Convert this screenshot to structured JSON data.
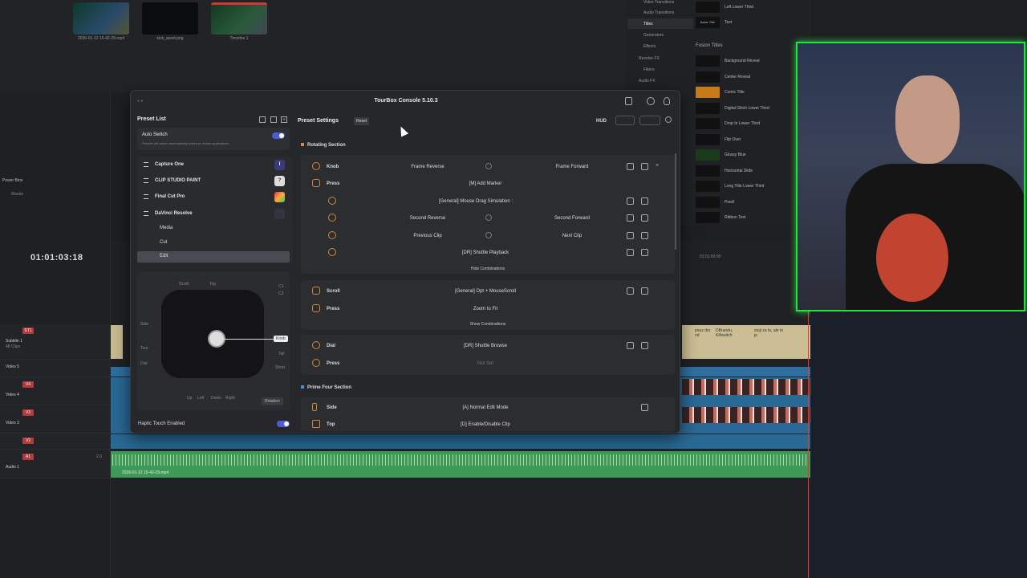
{
  "media_pool": {
    "clips": [
      {
        "label": "2026-01-12 15-42-29.mp4"
      },
      {
        "label": "kick_asset.png"
      },
      {
        "label": "Timeline 1"
      }
    ]
  },
  "left_panel": {
    "power_bins": "Power Bins",
    "master": "Master",
    "timecode": "01:01:03:18"
  },
  "tracks": [
    {
      "badge": "ST1",
      "name": "Subtitle 1",
      "sub": "48 Clips"
    },
    {
      "badge": "V5",
      "name": "Video 5"
    },
    {
      "badge": "V4",
      "name": "Video 4"
    },
    {
      "badge": "V3",
      "name": "Video 3"
    },
    {
      "badge": "V2",
      "name": ""
    },
    {
      "badge": "A1",
      "name": "Audio 1",
      "level": "2.0"
    }
  ],
  "audio_clip_label": "2026-01-12 15-42-29.mp4",
  "timeline_ruler": "01:01:00:00",
  "subtitle_clips": [
    "pouz dro od",
    "DBrandu, Killswitch",
    "stoji za to, ale to je"
  ],
  "effects": {
    "nav": [
      "Video Transitions",
      "Audio Transitions",
      "Titles",
      "Generators",
      "Effects",
      "Resolve FX",
      "Filters",
      "Audio FX"
    ],
    "top_items": [
      "Left Lower Third",
      "Text"
    ],
    "top_swatch": "Basic Title",
    "fusion_header": "Fusion Titles",
    "fusion_items": [
      "Background Reveal",
      "Center Reveal",
      "Comic Title",
      "Digital Glitch Lower Third",
      "Drop In Lower Third",
      "Flip Over",
      "Glossy Blue",
      "Horizontal Slide",
      "Long Title Lower Third",
      "Powll",
      "Ribbon Text"
    ],
    "swatch_texts": [
      "SAMPLE",
      "Glossy Blue"
    ]
  },
  "console": {
    "title": "TourBox Console 5.10.3",
    "preset_list_title": "Preset List",
    "auto_switch": "Auto Switch",
    "auto_switch_desc": "Presets will switch automatically based on linked applications.",
    "presets": [
      {
        "label": "Capture One"
      },
      {
        "label": "CLIP STUDIO PAINT"
      },
      {
        "label": "Final Cut Pro"
      },
      {
        "label": "DaVinci Resolve"
      }
    ],
    "sub_presets": [
      "Media",
      "Cut",
      "Edit"
    ],
    "device_labels": {
      "scroll": "Scroll",
      "top": "Top",
      "c1": "C1",
      "c2": "C2",
      "side": "Side",
      "tour": "Tour",
      "dial": "Dial",
      "knob": "Knob",
      "tall": "Tall",
      "short": "Short",
      "up": "Up",
      "left": "Left",
      "down": "Down",
      "right": "Right",
      "rotation": "Rotation"
    },
    "haptic": "Haptic Touch Enabled",
    "preset_settings": "Preset Settings",
    "reset": "Reset",
    "hud": "HUD",
    "rotating_section": "Rotating Section",
    "knob_rows": [
      {
        "name": "Knob",
        "left": "Frame Reverse",
        "right": "Frame Forward"
      },
      {
        "name": "Press",
        "center": "[M] Add Marker"
      },
      {
        "center": "[General] Mouse Drag Simulation :"
      },
      {
        "left": "Second Reverse",
        "right": "Second Forward"
      },
      {
        "left": "Previous Clip",
        "right": "Next Clip"
      },
      {
        "center": "[DR] Shuttle Playback"
      }
    ],
    "hide_combinations": "Hide Combinations",
    "scroll_rows": [
      {
        "name": "Scroll",
        "center": "[General] Opt + MouseScroll"
      },
      {
        "name": "Press",
        "center": "Zoom to Fit"
      }
    ],
    "show_combinations": "Show Combinations",
    "dial_rows": [
      {
        "name": "Dial",
        "center": "[DR] Shuttle Browse"
      },
      {
        "name": "Press",
        "center": "Not Set"
      }
    ],
    "prime_four_section": "Prime Four Section",
    "prime_rows": [
      {
        "name": "Side",
        "center": "[A] Normal Edit Mode"
      },
      {
        "name": "Top",
        "center": "[D] Enable/Disable Clip"
      }
    ]
  },
  "colors": {
    "accent": "#4b5bdc",
    "orange": "#e08a3a",
    "green_screen": "#27e23c",
    "track_badge": "#b33b3b"
  }
}
